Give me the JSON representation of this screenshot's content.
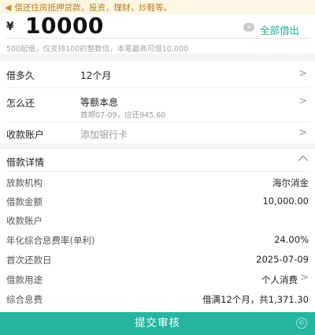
{
  "notice": {
    "icon": "speaker-icon",
    "text": "偿还住房抵押贷款，投资，理财，炒鞋等。"
  },
  "amount": {
    "currency_symbol": "¥",
    "value": "10000",
    "clear_icon": "clear-icon",
    "clear_glyph": "×",
    "borrow_all_label": "全部借出",
    "hint": "500起借，仅支持100的整数倍，本笔最高可借10,000"
  },
  "loan_options": {
    "term": {
      "label": "借多久",
      "value": "12个月"
    },
    "repayment": {
      "label": "怎么还",
      "value": "等额本息",
      "sub": "首期07-09，应还945.60"
    },
    "account": {
      "label": "收款账户",
      "placeholder": "添加银行卡"
    },
    "chevron": ">"
  },
  "details": {
    "title": "借款详情",
    "collapse_glyph": "^",
    "rows": [
      {
        "label": "放款机构",
        "value": "海尔消金"
      },
      {
        "label": "借款金额",
        "value": "10,000.00"
      },
      {
        "label": "收款账户",
        "value": ""
      },
      {
        "label": "年化综合息费率(单利)",
        "value": "24.00%"
      },
      {
        "label": "首次还款日",
        "value": "2025-07-09"
      },
      {
        "label": "借款用途",
        "value": "个人消费"
      },
      {
        "label": "综合息费",
        "value": "借满12个月，共1,371.30"
      }
    ]
  },
  "submit": {
    "label": "提交审核"
  },
  "theme": {
    "accent": "#25b5a0",
    "link": "#1fae9a",
    "notice_bg": "#fdf6e3",
    "notice_text": "#b7791f"
  }
}
